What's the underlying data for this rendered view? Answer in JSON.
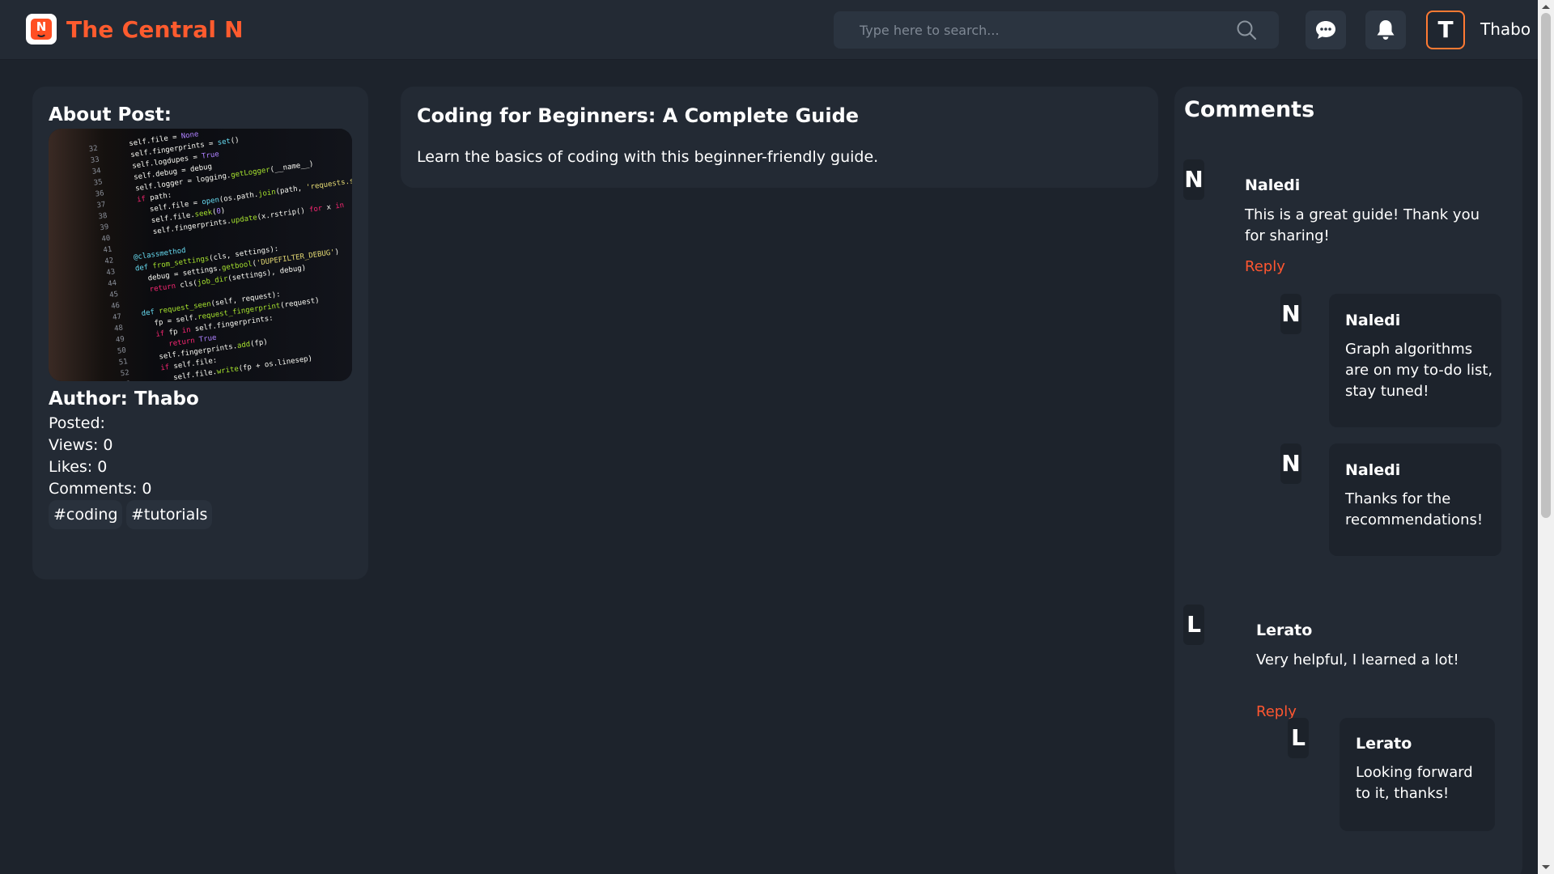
{
  "header": {
    "logo_letter": "N",
    "brand": "The Central N",
    "search_placeholder": "Type here to search...",
    "user_initial": "T",
    "username": "Thabo"
  },
  "about": {
    "title": "About Post:",
    "author": "Author: Thabo",
    "posted": "Posted:",
    "views": "Views: 0",
    "likes": "Likes: 0",
    "comments": "Comments: 0",
    "tags": [
      "#coding",
      "#tutorials"
    ]
  },
  "post": {
    "title": "Coding for Beginners: A Complete Guide",
    "description": "Learn the basics of coding with this beginner-friendly guide."
  },
  "comments": {
    "title": "Comments",
    "reply_label": "Reply",
    "items": [
      {
        "initial": "N",
        "name": "Naledi",
        "text": "This is a great guide! Thank you for sharing!",
        "replies": [
          {
            "initial": "N",
            "name": "Naledi",
            "text": "Graph algorithms are on my to-do list, stay tuned!"
          },
          {
            "initial": "N",
            "name": "Naledi",
            "text": "Thanks for the recommendations!"
          }
        ]
      },
      {
        "initial": "L",
        "name": "Lerato",
        "text": "Very helpful, I learned a lot!",
        "replies": [
          {
            "initial": "L",
            "name": "Lerato",
            "text": "Looking forward to it, thanks!"
          }
        ]
      }
    ]
  },
  "colors": {
    "accent": "#ff5630",
    "background": "#1d232c",
    "card": "#232a34"
  }
}
